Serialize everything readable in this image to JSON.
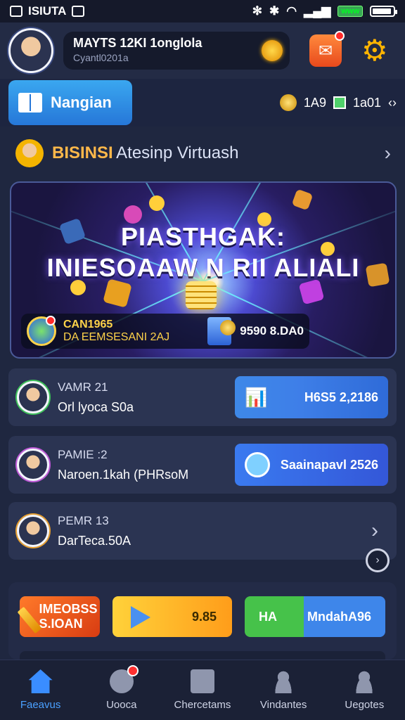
{
  "status": {
    "carrier": "ISIUTA",
    "battery_pill": "www"
  },
  "header": {
    "name": "MAYTS 12KI 1onglola",
    "subtitle": "Cyantl0201a"
  },
  "tabbar": {
    "active_label": "Nangian",
    "stat_a": "1A9",
    "stat_b": "1a01"
  },
  "section": {
    "title_highlight": "BISINSI",
    "title_rest": "Atesinp Virtuash"
  },
  "banner": {
    "title_line1": "PIASTHGAK:",
    "title_line2": "INIESOAAW N RII ALIALI",
    "footer_a": "CAN1965",
    "footer_b": "DA EEMSESANI 2AJ",
    "footer_value": "9590 8.DA0"
  },
  "cards": [
    {
      "line1": "VAMR 21",
      "line2": "Orl lyoca S0a",
      "button": "H6S5 2,2186"
    },
    {
      "line1": "PAMIE :2",
      "line2": "Naroen.1kah (PHRsoM",
      "button": "Saainapavl 2526"
    },
    {
      "line1": "PEMR 13",
      "line2": "DarTeca.50A"
    }
  ],
  "actions": {
    "a1_line1": "IMEOBSS",
    "a1_line2": "S.IOAN",
    "a2": "9.85",
    "a3_left": "HA",
    "a3_right": "MndahA96"
  },
  "nav": [
    "Faeavus",
    "Uooca",
    "Chercetams",
    "Vindantes",
    "Uegotes"
  ],
  "colors": {
    "accent": "#3a8dff",
    "coin": "#ffb400",
    "orange": "#e8491c",
    "green": "#46c24a"
  }
}
